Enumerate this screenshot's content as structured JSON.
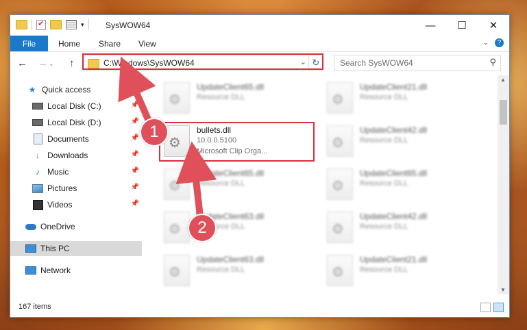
{
  "window": {
    "title": "SysWOW64",
    "controls": {
      "minimize": "—",
      "maximize": "☐",
      "close": "✕"
    }
  },
  "ribbon": {
    "tabs": [
      "File",
      "Home",
      "Share",
      "View"
    ],
    "help": "?"
  },
  "navigation": {
    "back": "←",
    "forward": "→",
    "up": "↑",
    "address": "C:\\Windows\\SysWOW64",
    "search_placeholder": "Search SysWOW64"
  },
  "sidebar": {
    "items": [
      {
        "label": "Quick access",
        "icon": "star-icon",
        "pinned": false
      },
      {
        "label": "Local Disk (C:)",
        "icon": "drive-icon",
        "pinned": true
      },
      {
        "label": "Local Disk (D:)",
        "icon": "drive-icon",
        "pinned": true
      },
      {
        "label": "Documents",
        "icon": "documents-icon",
        "pinned": true
      },
      {
        "label": "Downloads",
        "icon": "download-icon",
        "pinned": true
      },
      {
        "label": "Music",
        "icon": "music-icon",
        "pinned": true
      },
      {
        "label": "Pictures",
        "icon": "pictures-icon",
        "pinned": true
      },
      {
        "label": "Videos",
        "icon": "videos-icon",
        "pinned": true
      },
      {
        "label": "OneDrive",
        "icon": "cloud-icon",
        "pinned": false
      },
      {
        "label": "This PC",
        "icon": "computer-icon",
        "pinned": false,
        "selected": true
      },
      {
        "label": "Network",
        "icon": "network-icon",
        "pinned": false
      }
    ]
  },
  "files": {
    "col1": [
      {
        "name": "UpdateClient65.dll",
        "desc": "Resource DLL"
      },
      {
        "name": "bullets.dll",
        "desc": "10.0.0.5100",
        "desc2": "Microsoft Clip Orga...",
        "highlighted": true
      },
      {
        "name": "UpdateClient65.dll",
        "desc": "Resource DLL"
      },
      {
        "name": "UpdateClient63.dll",
        "desc": "Resource DLL"
      },
      {
        "name": "UpdateClient63.dll",
        "desc": "Resource DLL"
      }
    ],
    "col2": [
      {
        "name": "UpdateClient21.dll",
        "desc": "Resource DLL"
      },
      {
        "name": "UpdateClient42.dll",
        "desc": "Resource DLL"
      },
      {
        "name": "UpdateClient65.dll",
        "desc": "Resource DLL"
      },
      {
        "name": "UpdateClient42.dll",
        "desc": "Resource DLL"
      },
      {
        "name": "UpdateClient21.dll",
        "desc": "Resource DLL"
      }
    ]
  },
  "annotations": {
    "step1": "1",
    "step2": "2"
  },
  "status": {
    "item_count": "167 items"
  },
  "colors": {
    "accent": "#1979ca",
    "highlight": "#d9303b",
    "badge": "#e0505a"
  }
}
